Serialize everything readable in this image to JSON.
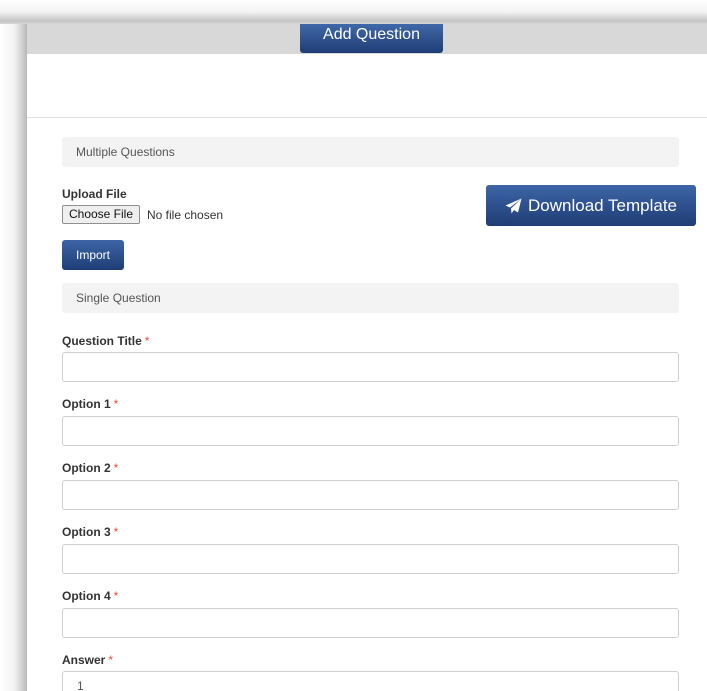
{
  "header": {
    "tab_label": "Add Question"
  },
  "multiple_section": {
    "title": "Multiple Questions",
    "upload_label": "Upload File",
    "choose_file_label": "Choose File",
    "file_status": "No file chosen",
    "download_label": "Download Template",
    "import_label": "Import"
  },
  "single_section": {
    "title": "Single Question",
    "question_title_label": "Question Title",
    "option1_label": "Option 1",
    "option2_label": "Option 2",
    "option3_label": "Option 3",
    "option4_label": "Option 4",
    "answer_label": "Answer",
    "answer_value": "1",
    "required_mark": "*"
  },
  "icons": {
    "download": "paper-plane-icon",
    "select": "chevron-down-icon"
  },
  "colors": {
    "primary": "#2a4a85",
    "required": "#e74c3c"
  }
}
